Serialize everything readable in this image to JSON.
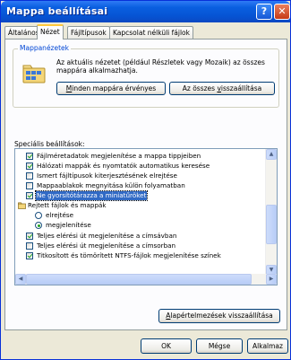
{
  "window": {
    "title": "Mappa beállításai"
  },
  "titlebar": {
    "help_label": "?",
    "close_label": "✕"
  },
  "tabs": [
    {
      "label": "Általános",
      "active": false
    },
    {
      "label": "Nézet",
      "active": true
    },
    {
      "label": "Fájltípusok",
      "active": false
    },
    {
      "label": "Kapcsolat nélküli fájlok",
      "active": false
    }
  ],
  "folder_views": {
    "title": "Mappanézetek",
    "description": "Az aktuális nézetet (például Részletek vagy Mozaik) az összes mappára alkalmazhatja.",
    "apply_all_button": {
      "pre": "",
      "underlined": "M",
      "post": "inden mappára érvényes"
    },
    "reset_all_button": {
      "pre": "Az összes ",
      "underlined": "v",
      "post": "isszaállítása"
    }
  },
  "advanced": {
    "label": "Speciális beállítások:",
    "items": [
      {
        "type": "checkbox",
        "checked": true,
        "label": "Fájlméretadatok megjelenítése a mappa tippjeiben"
      },
      {
        "type": "checkbox",
        "checked": true,
        "label": "Hálózati mappák és nyomtatók automatikus keresése"
      },
      {
        "type": "checkbox",
        "checked": false,
        "label": "Ismert fájltípusok kiterjesztésének elrejtése"
      },
      {
        "type": "checkbox",
        "checked": false,
        "label": "Mappaablakok megnyitása külön folyamatban"
      },
      {
        "type": "checkbox",
        "checked": true,
        "selected": true,
        "label": "Ne gyorsítótárazza a miniatűröket"
      },
      {
        "type": "folder",
        "label": "Rejtett fájlok és mappák"
      },
      {
        "type": "radio",
        "checked": false,
        "label": "elrejtése"
      },
      {
        "type": "radio",
        "checked": true,
        "label": "megjelenítése"
      },
      {
        "type": "checkbox",
        "checked": true,
        "label": "Teljes elérési út megjelenítése a címsávban"
      },
      {
        "type": "checkbox",
        "checked": false,
        "label": "Teljes elérési út megjelenítése a címsorban"
      },
      {
        "type": "checkbox",
        "checked": true,
        "label": "Titkosított és tömörített NTFS-fájlok megjelenítése színek"
      }
    ]
  },
  "restore_defaults_button": {
    "pre": "",
    "underlined": "A",
    "post": "lapértelmezések visszaállítása"
  },
  "footer": {
    "ok_label": "OK",
    "cancel_label": "Mégse",
    "apply_label": "Alkalmaz"
  },
  "colors": {
    "titlebar": "#0654d4",
    "dialog_bg": "#ece9d8",
    "selection": "#316ac5",
    "check": "#21a121",
    "group_title": "#0046d5"
  }
}
